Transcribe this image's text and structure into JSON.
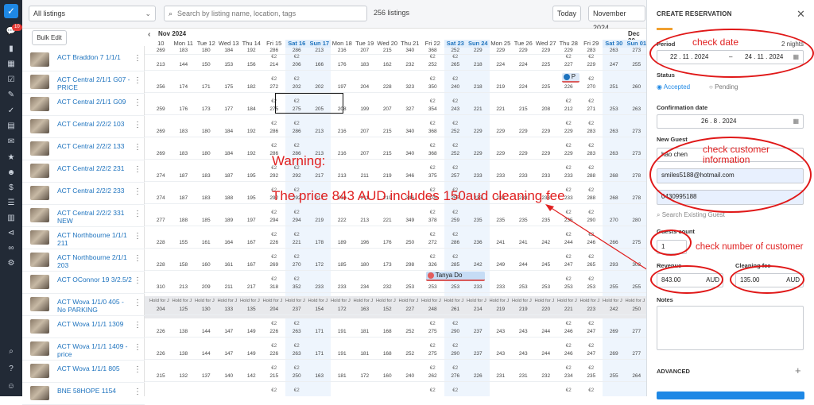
{
  "sidebar": {
    "badge": "10"
  },
  "topbar": {
    "listings_filter": "All listings",
    "search_placeholder": "Search by listing name, location, tags",
    "listing_count": "256 listings",
    "today": "Today",
    "month": "November 2024",
    "bulk_edit": "Bulk Edit"
  },
  "calendar": {
    "month_label": "Nov 2024",
    "next_month_label": "Dec 20",
    "days": [
      {
        "d": "10",
        "w": false
      },
      {
        "d": "Mon 11",
        "w": false
      },
      {
        "d": "Tue 12",
        "w": false
      },
      {
        "d": "Wed 13",
        "w": false
      },
      {
        "d": "Thu 14",
        "w": false
      },
      {
        "d": "Fri 15",
        "w": false
      },
      {
        "d": "Sat 16",
        "w": true
      },
      {
        "d": "Sun 17",
        "w": true
      },
      {
        "d": "Mon 18",
        "w": false
      },
      {
        "d": "Tue 19",
        "w": false
      },
      {
        "d": "Wed 20",
        "w": false
      },
      {
        "d": "Thu 21",
        "w": false
      },
      {
        "d": "Fri 22",
        "w": false
      },
      {
        "d": "Sat 23",
        "w": true
      },
      {
        "d": "Sun 24",
        "w": true
      },
      {
        "d": "Mon 25",
        "w": false
      },
      {
        "d": "Tue 26",
        "w": false
      },
      {
        "d": "Wed 27",
        "w": false
      },
      {
        "d": "Thu 28",
        "w": false
      },
      {
        "d": "Fri 29",
        "w": false
      },
      {
        "d": "Sat 30",
        "w": true
      },
      {
        "d": "Sun 01",
        "w": true
      }
    ],
    "listings": [
      {
        "name": "ACT Braddon 7 1/1/1",
        "prices": [
          "213",
          "144",
          "150",
          "153",
          "156",
          "214",
          "206",
          "166",
          "176",
          "183",
          "162",
          "232",
          "252",
          "265",
          "218",
          "224",
          "224",
          "225",
          "227",
          "229",
          "247",
          "255"
        ]
      },
      {
        "name": "ACT Central 2/1/1 G07 - PRICE",
        "prices": [
          "256",
          "174",
          "171",
          "175",
          "182",
          "272",
          "202",
          "202",
          "197",
          "204",
          "228",
          "323",
          "350",
          "240",
          "218",
          "219",
          "224",
          "225",
          "226",
          "270",
          "251",
          "260"
        ]
      },
      {
        "name": "ACT Central 2/1/1 G09",
        "prices": [
          "259",
          "176",
          "173",
          "177",
          "184",
          "275",
          "275",
          "205",
          "208",
          "199",
          "207",
          "327",
          "354",
          "243",
          "221",
          "221",
          "215",
          "208",
          "212",
          "271",
          "253",
          "263"
        ]
      },
      {
        "name": "ACT Central 2/2/2 103",
        "prices": [
          "269",
          "183",
          "180",
          "184",
          "192",
          "286",
          "286",
          "213",
          "216",
          "207",
          "215",
          "340",
          "368",
          "252",
          "229",
          "229",
          "229",
          "229",
          "229",
          "283",
          "263",
          "273"
        ]
      },
      {
        "name": "ACT Central 2/2/2 133",
        "prices": [
          "269",
          "183",
          "180",
          "184",
          "192",
          "286",
          "286",
          "213",
          "216",
          "207",
          "215",
          "340",
          "368",
          "252",
          "229",
          "229",
          "229",
          "229",
          "229",
          "283",
          "263",
          "273"
        ]
      },
      {
        "name": "ACT Central 2/2/2 231",
        "prices": [
          "274",
          "187",
          "183",
          "187",
          "195",
          "292",
          "292",
          "217",
          "213",
          "211",
          "219",
          "346",
          "375",
          "257",
          "233",
          "233",
          "233",
          "233",
          "233",
          "288",
          "268",
          "278"
        ]
      },
      {
        "name": "ACT Central 2/2/2 233",
        "prices": [
          "274",
          "187",
          "183",
          "188",
          "195",
          "292",
          "292",
          "217",
          "213",
          "211",
          "219",
          "346",
          "375",
          "257",
          "233",
          "233",
          "233",
          "233",
          "233",
          "288",
          "268",
          "278"
        ]
      },
      {
        "name": "ACT Central 2/2/2 331 NEW",
        "prices": [
          "277",
          "188",
          "185",
          "189",
          "197",
          "294",
          "294",
          "219",
          "222",
          "213",
          "221",
          "349",
          "378",
          "259",
          "235",
          "235",
          "235",
          "235",
          "235",
          "290",
          "270",
          "280"
        ]
      },
      {
        "name": "ACT Northbourne 1/1/1 211",
        "prices": [
          "228",
          "155",
          "161",
          "164",
          "167",
          "226",
          "221",
          "178",
          "189",
          "196",
          "176",
          "250",
          "272",
          "286",
          "236",
          "241",
          "241",
          "242",
          "244",
          "246",
          "266",
          "275"
        ]
      },
      {
        "name": "ACT Northbourne 2/1/1 203",
        "prices": [
          "228",
          "158",
          "160",
          "161",
          "167",
          "269",
          "270",
          "172",
          "185",
          "180",
          "173",
          "298",
          "326",
          "285",
          "242",
          "249",
          "244",
          "245",
          "247",
          "265",
          "293",
          "303"
        ]
      },
      {
        "name": "ACT OConnor 19 3/2.5/2",
        "prices": [
          "310",
          "213",
          "209",
          "211",
          "217",
          "318",
          "352",
          "233",
          "233",
          "234",
          "232",
          "253",
          "253",
          "253",
          "233",
          "233",
          "253",
          "253",
          "253",
          "253",
          "255",
          "255"
        ]
      },
      {
        "name": "ACT Wova 1/1/0 405 - No PARKING",
        "prices": [
          "204",
          "125",
          "130",
          "133",
          "135",
          "204",
          "237",
          "154",
          "172",
          "163",
          "152",
          "227",
          "248",
          "261",
          "214",
          "219",
          "219",
          "220",
          "221",
          "223",
          "242",
          "250"
        ]
      },
      {
        "name": "ACT Wova 1/1/1 1309",
        "prices": [
          "226",
          "138",
          "144",
          "147",
          "149",
          "226",
          "263",
          "171",
          "191",
          "181",
          "168",
          "252",
          "275",
          "290",
          "237",
          "243",
          "243",
          "244",
          "246",
          "247",
          "269",
          "277"
        ]
      },
      {
        "name": "ACT Wova 1/1/1 1409 - price",
        "prices": [
          "226",
          "138",
          "144",
          "147",
          "149",
          "226",
          "263",
          "171",
          "191",
          "181",
          "168",
          "252",
          "275",
          "290",
          "237",
          "243",
          "243",
          "244",
          "246",
          "247",
          "269",
          "277"
        ]
      },
      {
        "name": "ACT Wova 1/1/1 805",
        "prices": [
          "215",
          "132",
          "137",
          "140",
          "142",
          "215",
          "250",
          "163",
          "181",
          "172",
          "160",
          "240",
          "262",
          "276",
          "226",
          "231",
          "231",
          "232",
          "234",
          "235",
          "255",
          "264"
        ]
      },
      {
        "name": "BNE 58HOPE 1154",
        "prices": [
          "",
          "",
          "",
          "",
          "",
          "",
          "",
          "",
          "",
          "",
          "",
          "",
          "",
          "",
          "",
          "",
          "",
          "",
          "",
          "",
          "",
          ""
        ]
      }
    ],
    "top_prices": [
      "269",
      "183",
      "180",
      "184",
      "192",
      "286",
      "286",
      "213",
      "216",
      "207",
      "215",
      "340",
      "368",
      "252",
      "229",
      "229",
      "229",
      "229",
      "229",
      "283",
      "263",
      "273"
    ],
    "euro_mark": "€2",
    "hold_text": "Hold for J",
    "reservations": [
      {
        "label": "Tanya Do"
      },
      {
        "label": "P"
      }
    ]
  },
  "annotations": {
    "warning_title": "Warning:",
    "warning_text": "The price 843 AUD includes 150aud cleaning fee",
    "check_date": "check date",
    "check_customer": "check customer information",
    "check_number": "check number of customer"
  },
  "panel": {
    "title": "CREATE RESERVATION",
    "period_label": "Period",
    "nights": "2 nights",
    "checkin": "22 . 11 . 2024",
    "dash": "–",
    "checkout": "24 . 11 . 2024",
    "status_label": "Status",
    "status_accepted": "Accepted",
    "status_pending": "Pending",
    "confirmation_label": "Confirmation date",
    "confirmation_date": "26 . 8 . 2024",
    "new_guest_label": "New Guest",
    "guest_name": "hao chen",
    "guest_email": "smiles5188@hotmail.com",
    "guest_phone": "0430995188",
    "search_guest": "Search Existing Guest",
    "guests_count_label": "Guests count",
    "guests_count": "1",
    "revenue_label": "Revenue",
    "revenue": "843.00",
    "currency": "AUD",
    "cleaning_label": "Cleaning fee",
    "cleaning": "135.00",
    "notes_label": "Notes",
    "advanced_label": "ADVANCED"
  },
  "colors": {
    "accent": "#1e88e5",
    "annotation_red": "#e02020",
    "rail": "#222a36"
  }
}
